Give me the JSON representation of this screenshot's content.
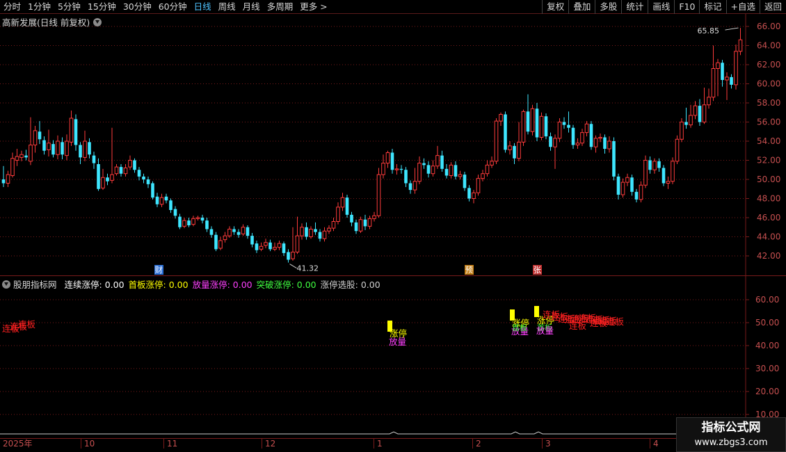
{
  "toolbar": {
    "periods": [
      "分时",
      "1分钟",
      "5分钟",
      "15分钟",
      "30分钟",
      "60分钟",
      "日线",
      "周线",
      "月线",
      "多周期",
      "更多 >"
    ],
    "active_period": "日线",
    "buttons": [
      "复权",
      "叠加",
      "多股",
      "统计",
      "画线",
      "F10",
      "标记",
      "+自选",
      "返回"
    ]
  },
  "main": {
    "title": "高新发展(日线 前复权)",
    "price_axis": [
      "66.00",
      "64.00",
      "62.00",
      "60.00",
      "58.00",
      "56.00",
      "54.00",
      "52.00",
      "50.00",
      "48.00",
      "46.00",
      "44.00",
      "42.00"
    ],
    "high_label": "65.85",
    "low_label": "41.32",
    "markers": [
      "财",
      "预",
      "张"
    ]
  },
  "indicator": {
    "name": "股朋指标网",
    "legend": [
      {
        "label": "连续涨停: 0.00",
        "color": "#ffffff"
      },
      {
        "label": "首板涨停: 0.00",
        "color": "#ffff00"
      },
      {
        "label": "放量涨停: 0.00",
        "color": "#ff40ff"
      },
      {
        "label": "突破涨停: 0.00",
        "color": "#40ff40"
      },
      {
        "label": "涨停选股: 0.00",
        "color": "#d0d0d0"
      }
    ],
    "axis": [
      "60.00",
      "50.00",
      "40.00",
      "30.00",
      "20.00",
      "10.00"
    ],
    "signals": {
      "lianban": "连板",
      "zhangting": "涨停",
      "shoubanA": "首板",
      "fangliang": "放量"
    }
  },
  "xaxis": [
    "2025年",
    "10",
    "11",
    "12",
    "1",
    "2",
    "3",
    "4"
  ],
  "watermark": {
    "title": "指标公式网",
    "url": "www.zbgs3.com"
  },
  "colors": {
    "up": "#ff3b3b",
    "down": "#3ee6ff",
    "grid": "#7a1a1a",
    "axis_text": "#c85050"
  },
  "chart_data": {
    "type": "candlestick",
    "ylim": [
      41,
      67
    ],
    "candles": [
      [
        50.0,
        49.6,
        51.4,
        49.2
      ],
      [
        49.6,
        50.5,
        50.9,
        49.2
      ],
      [
        50.4,
        52.2,
        52.8,
        50.2
      ],
      [
        52.0,
        52.4,
        53.2,
        51.4
      ],
      [
        52.3,
        52.6,
        53.0,
        51.9
      ],
      [
        52.5,
        52.3,
        53.1,
        52.0
      ],
      [
        51.9,
        53.6,
        56.5,
        51.5
      ],
      [
        53.6,
        55.1,
        55.6,
        52.8
      ],
      [
        55.0,
        54.2,
        56.1,
        53.7
      ],
      [
        54.1,
        53.0,
        54.5,
        52.6
      ],
      [
        53.1,
        53.8,
        55.2,
        52.4
      ],
      [
        53.7,
        52.6,
        54.1,
        52.3
      ],
      [
        52.6,
        54.0,
        54.6,
        52.1
      ],
      [
        53.9,
        52.6,
        54.4,
        52.1
      ],
      [
        52.5,
        54.0,
        54.7,
        52.0
      ],
      [
        53.9,
        56.4,
        57.2,
        53.5
      ],
      [
        56.3,
        53.6,
        56.8,
        53.0
      ],
      [
        53.6,
        52.3,
        53.9,
        51.6
      ],
      [
        52.3,
        54.0,
        55.1,
        51.9
      ],
      [
        53.9,
        52.6,
        54.3,
        52.2
      ],
      [
        52.5,
        51.7,
        52.9,
        51.1
      ],
      [
        51.6,
        49.0,
        52.2,
        48.8
      ],
      [
        49.1,
        50.2,
        51.1,
        48.9
      ],
      [
        50.2,
        49.8,
        50.6,
        49.4
      ],
      [
        49.9,
        50.5,
        55.4,
        49.6
      ],
      [
        50.6,
        51.3,
        51.6,
        50.4
      ],
      [
        51.3,
        50.6,
        51.6,
        50.3
      ],
      [
        50.6,
        51.2,
        51.6,
        50.3
      ],
      [
        51.3,
        52.0,
        52.5,
        51.0
      ],
      [
        52.0,
        51.0,
        52.2,
        50.7
      ],
      [
        51.0,
        50.3,
        51.3,
        49.9
      ],
      [
        50.3,
        50.0,
        50.6,
        49.6
      ],
      [
        50.0,
        49.5,
        50.3,
        49.1
      ],
      [
        49.6,
        48.1,
        49.8,
        47.9
      ],
      [
        48.2,
        47.4,
        48.6,
        47.1
      ],
      [
        47.4,
        48.1,
        48.5,
        47.1
      ],
      [
        48.2,
        47.8,
        48.5,
        47.5
      ],
      [
        47.8,
        46.8,
        48.0,
        46.5
      ],
      [
        46.9,
        46.2,
        47.2,
        45.9
      ],
      [
        46.1,
        45.0,
        46.4,
        44.8
      ],
      [
        45.1,
        45.7,
        46.0,
        44.9
      ],
      [
        45.7,
        45.2,
        46.0,
        45.0
      ],
      [
        45.3,
        45.9,
        46.2,
        45.1
      ],
      [
        45.9,
        46.0,
        46.2,
        45.7
      ],
      [
        46.0,
        45.7,
        46.3,
        45.4
      ],
      [
        45.7,
        44.8,
        46.0,
        44.5
      ],
      [
        44.8,
        44.2,
        45.1,
        43.9
      ],
      [
        44.2,
        42.7,
        44.5,
        42.5
      ],
      [
        42.8,
        43.6,
        44.0,
        42.6
      ],
      [
        43.7,
        44.1,
        44.5,
        43.4
      ],
      [
        44.1,
        44.8,
        45.1,
        43.9
      ],
      [
        44.8,
        44.5,
        45.1,
        44.2
      ],
      [
        44.5,
        44.2,
        44.8,
        43.9
      ],
      [
        44.3,
        45.0,
        45.3,
        44.1
      ],
      [
        45.0,
        44.1,
        45.2,
        43.8
      ],
      [
        44.1,
        43.2,
        44.4,
        42.9
      ],
      [
        43.3,
        42.6,
        43.6,
        42.3
      ],
      [
        42.7,
        43.0,
        43.4,
        42.5
      ],
      [
        43.1,
        43.4,
        43.8,
        42.8
      ],
      [
        43.4,
        42.7,
        43.7,
        42.5
      ],
      [
        42.7,
        42.9,
        43.4,
        42.5
      ],
      [
        42.9,
        43.3,
        43.6,
        42.6
      ],
      [
        43.3,
        42.3,
        43.5,
        42.0
      ],
      [
        42.4,
        41.6,
        42.7,
        41.3
      ],
      [
        41.7,
        42.4,
        45.0,
        41.5
      ],
      [
        42.4,
        44.1,
        46.1,
        42.2
      ],
      [
        44.1,
        45.0,
        45.4,
        43.7
      ],
      [
        45.0,
        44.0,
        45.5,
        43.7
      ],
      [
        44.0,
        44.8,
        45.1,
        43.8
      ],
      [
        44.8,
        44.5,
        45.5,
        44.2
      ],
      [
        44.5,
        43.8,
        44.8,
        43.5
      ],
      [
        43.8,
        44.6,
        45.0,
        43.5
      ],
      [
        44.6,
        44.9,
        45.2,
        44.3
      ],
      [
        44.9,
        45.6,
        46.0,
        44.6
      ],
      [
        45.6,
        47.1,
        47.6,
        45.3
      ],
      [
        47.1,
        48.1,
        48.6,
        46.7
      ],
      [
        48.1,
        46.3,
        48.4,
        46.0
      ],
      [
        46.3,
        45.5,
        46.6,
        45.1
      ],
      [
        45.5,
        44.6,
        45.8,
        44.3
      ],
      [
        44.6,
        45.8,
        46.1,
        44.4
      ],
      [
        45.8,
        45.1,
        46.3,
        44.7
      ],
      [
        45.1,
        45.9,
        46.2,
        44.8
      ],
      [
        45.9,
        46.2,
        46.6,
        45.6
      ],
      [
        46.2,
        50.5,
        51.2,
        46.0
      ],
      [
        50.5,
        51.7,
        52.6,
        50.1
      ],
      [
        51.7,
        52.8,
        53.0,
        51.2
      ],
      [
        52.8,
        51.0,
        53.2,
        50.6
      ],
      [
        51.0,
        51.1,
        51.6,
        50.5
      ],
      [
        51.1,
        51.0,
        51.5,
        50.6
      ],
      [
        51.0,
        49.6,
        51.3,
        49.2
      ],
      [
        49.6,
        48.9,
        49.9,
        48.5
      ],
      [
        48.9,
        49.8,
        51.2,
        48.5
      ],
      [
        49.8,
        51.7,
        52.4,
        49.5
      ],
      [
        51.7,
        51.5,
        52.2,
        51.1
      ],
      [
        51.5,
        50.6,
        51.9,
        50.2
      ],
      [
        50.6,
        51.4,
        52.0,
        50.3
      ],
      [
        51.4,
        52.5,
        53.5,
        51.1
      ],
      [
        52.5,
        51.1,
        53.0,
        50.8
      ],
      [
        51.1,
        50.4,
        51.6,
        50.1
      ],
      [
        50.4,
        51.5,
        51.8,
        50.1
      ],
      [
        51.5,
        50.3,
        51.9,
        50.0
      ],
      [
        50.3,
        50.5,
        50.9,
        50.0
      ],
      [
        50.5,
        49.1,
        50.8,
        48.8
      ],
      [
        49.1,
        48.0,
        49.4,
        47.7
      ],
      [
        48.0,
        48.6,
        48.9,
        47.5
      ],
      [
        48.6,
        50.1,
        50.5,
        48.3
      ],
      [
        50.1,
        50.6,
        51.0,
        49.8
      ],
      [
        50.6,
        51.5,
        52.0,
        50.3
      ],
      [
        51.5,
        51.9,
        52.4,
        51.2
      ],
      [
        51.9,
        56.1,
        56.4,
        51.6
      ],
      [
        56.1,
        56.8,
        57.0,
        55.6
      ],
      [
        56.8,
        53.1,
        57.1,
        52.8
      ],
      [
        53.1,
        53.5,
        54.0,
        52.6
      ],
      [
        53.5,
        52.2,
        53.8,
        51.6
      ],
      [
        52.2,
        53.9,
        56.0,
        51.9
      ],
      [
        53.9,
        57.1,
        57.3,
        53.5
      ],
      [
        57.1,
        55.0,
        58.9,
        54.7
      ],
      [
        55.0,
        57.4,
        57.8,
        54.6
      ],
      [
        57.4,
        54.4,
        58.0,
        54.0
      ],
      [
        54.4,
        56.6,
        57.0,
        54.1
      ],
      [
        56.6,
        54.5,
        56.9,
        54.2
      ],
      [
        54.5,
        53.4,
        54.9,
        53.0
      ],
      [
        53.4,
        54.3,
        54.7,
        51.1
      ],
      [
        54.3,
        56.0,
        56.4,
        53.9
      ],
      [
        56.0,
        55.7,
        56.5,
        55.3
      ],
      [
        55.7,
        55.4,
        57.1,
        54.9
      ],
      [
        55.4,
        53.6,
        55.7,
        53.2
      ],
      [
        53.6,
        53.8,
        54.3,
        53.2
      ],
      [
        53.8,
        54.9,
        55.3,
        53.5
      ],
      [
        54.9,
        55.8,
        56.1,
        54.5
      ],
      [
        55.8,
        53.4,
        56.1,
        53.1
      ],
      [
        53.4,
        54.3,
        54.6,
        52.8
      ],
      [
        54.3,
        54.4,
        54.8,
        53.9
      ],
      [
        54.4,
        53.2,
        54.7,
        52.7
      ],
      [
        53.2,
        54.0,
        54.5,
        52.8
      ],
      [
        54.0,
        50.3,
        54.4,
        49.9
      ],
      [
        50.3,
        48.4,
        50.6,
        47.9
      ],
      [
        48.4,
        49.7,
        50.1,
        48.1
      ],
      [
        49.7,
        50.2,
        50.6,
        49.3
      ],
      [
        50.2,
        48.7,
        50.5,
        48.3
      ],
      [
        48.7,
        47.9,
        49.0,
        47.6
      ],
      [
        47.9,
        49.4,
        49.8,
        47.6
      ],
      [
        49.4,
        52.0,
        52.5,
        49.1
      ],
      [
        52.0,
        51.0,
        52.4,
        50.6
      ],
      [
        51.0,
        51.9,
        52.2,
        50.6
      ],
      [
        51.9,
        51.2,
        52.2,
        50.8
      ],
      [
        51.2,
        49.6,
        51.5,
        49.3
      ],
      [
        49.6,
        49.8,
        50.3,
        49.0
      ],
      [
        49.8,
        51.9,
        52.3,
        49.5
      ],
      [
        51.9,
        54.2,
        54.6,
        51.6
      ],
      [
        54.2,
        56.0,
        56.4,
        53.9
      ],
      [
        56.0,
        55.7,
        57.5,
        55.3
      ],
      [
        55.7,
        56.7,
        57.8,
        55.4
      ],
      [
        56.7,
        57.7,
        58.2,
        56.3
      ],
      [
        57.7,
        56.0,
        58.4,
        55.6
      ],
      [
        56.0,
        57.8,
        59.6,
        55.8
      ],
      [
        57.8,
        58.6,
        59.5,
        57.4
      ],
      [
        58.6,
        61.6,
        64.0,
        58.2
      ],
      [
        61.6,
        62.2,
        62.6,
        58.7
      ],
      [
        62.2,
        60.4,
        62.5,
        59.7
      ],
      [
        60.4,
        60.7,
        61.2,
        58.3
      ],
      [
        60.7,
        59.9,
        61.0,
        59.5
      ],
      [
        59.9,
        63.4,
        64.1,
        59.4
      ],
      [
        63.4,
        64.6,
        65.85,
        63.0
      ]
    ]
  }
}
